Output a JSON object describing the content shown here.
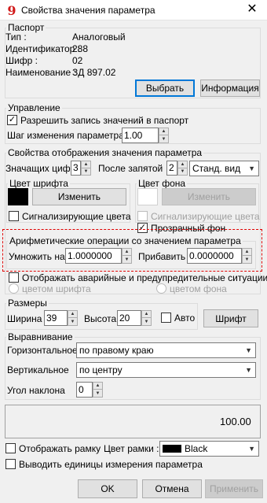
{
  "window": {
    "title": "Свойства значения параметра",
    "close_label": "✕"
  },
  "passport": {
    "group_label": "Паспорт",
    "rows": [
      {
        "label": "Тип :",
        "value": "Аналоговый"
      },
      {
        "label": "Идентификатор :",
        "value": "288"
      },
      {
        "label": "Шифр :",
        "value": "02"
      },
      {
        "label": "Наименование :",
        "value": "ЗД 897.02"
      }
    ],
    "select_button": "Выбрать",
    "info_button": "Информация"
  },
  "control": {
    "group_label": "Управление",
    "allow_write_label": "Разрешить запись значений в паспорт",
    "allow_write_checked": true,
    "step_label": "Шаг изменения параметра",
    "step_value": "1.00"
  },
  "display": {
    "group_label": "Свойства отображения значения параметра",
    "digits_label": "Значащих цифр",
    "digits_value": "3",
    "after_comma_label": "После запятой",
    "after_comma_value": "2",
    "view_value": "Станд. вид",
    "font_color": {
      "group_label": "Цвет шрифта",
      "swatch_color": "#000000",
      "change_button": "Изменить",
      "signal_colors_label": "Сигнализирующие цвета",
      "signal_colors_checked": false
    },
    "bg_color": {
      "group_label": "Цвет фона",
      "swatch_color": "#ffffff",
      "change_button": "Изменить",
      "signal_colors_label": "Сигнализирующие цвета",
      "transparent_label": "Прозрачный фон",
      "transparent_checked": true
    },
    "arith": {
      "group_label": "Арифметические операции со значением параметра",
      "multiply_label": "Умножить на",
      "multiply_value": "1.0000000",
      "add_label": "Прибавить",
      "add_value": "0.0000000"
    },
    "alarm_label": "Отображать аварийные и предупредительные ситуации",
    "alarm_checked": false,
    "radio_font_label": "цветом шрифта",
    "radio_bg_label": "цветом фона"
  },
  "sizes": {
    "group_label": "Размеры",
    "width_label": "Ширина",
    "width_value": "39",
    "height_label": "Высота",
    "height_value": "20",
    "auto_label": "Авто",
    "font_button": "Шрифт"
  },
  "align": {
    "group_label": "Выравнивание",
    "horizontal_label": "Горизонтальное",
    "horizontal_value": "по правому краю",
    "vertical_label": "Вертикальное",
    "vertical_value": "по центру",
    "angle_label": "Угол наклона",
    "angle_value": "0"
  },
  "preview": {
    "value": "100.00"
  },
  "frame": {
    "show_frame_label": "Отображать рамку",
    "frame_color_label": "Цвет рамки :",
    "frame_color_value": "Black",
    "frame_color_hex": "#000000",
    "units_label": "Выводить единицы измерения параметра"
  },
  "footer": {
    "ok": "OK",
    "cancel": "Отмена",
    "apply": "Применить"
  },
  "colors": {
    "accent": "#0078d7",
    "highlight_border": "#e00000"
  }
}
